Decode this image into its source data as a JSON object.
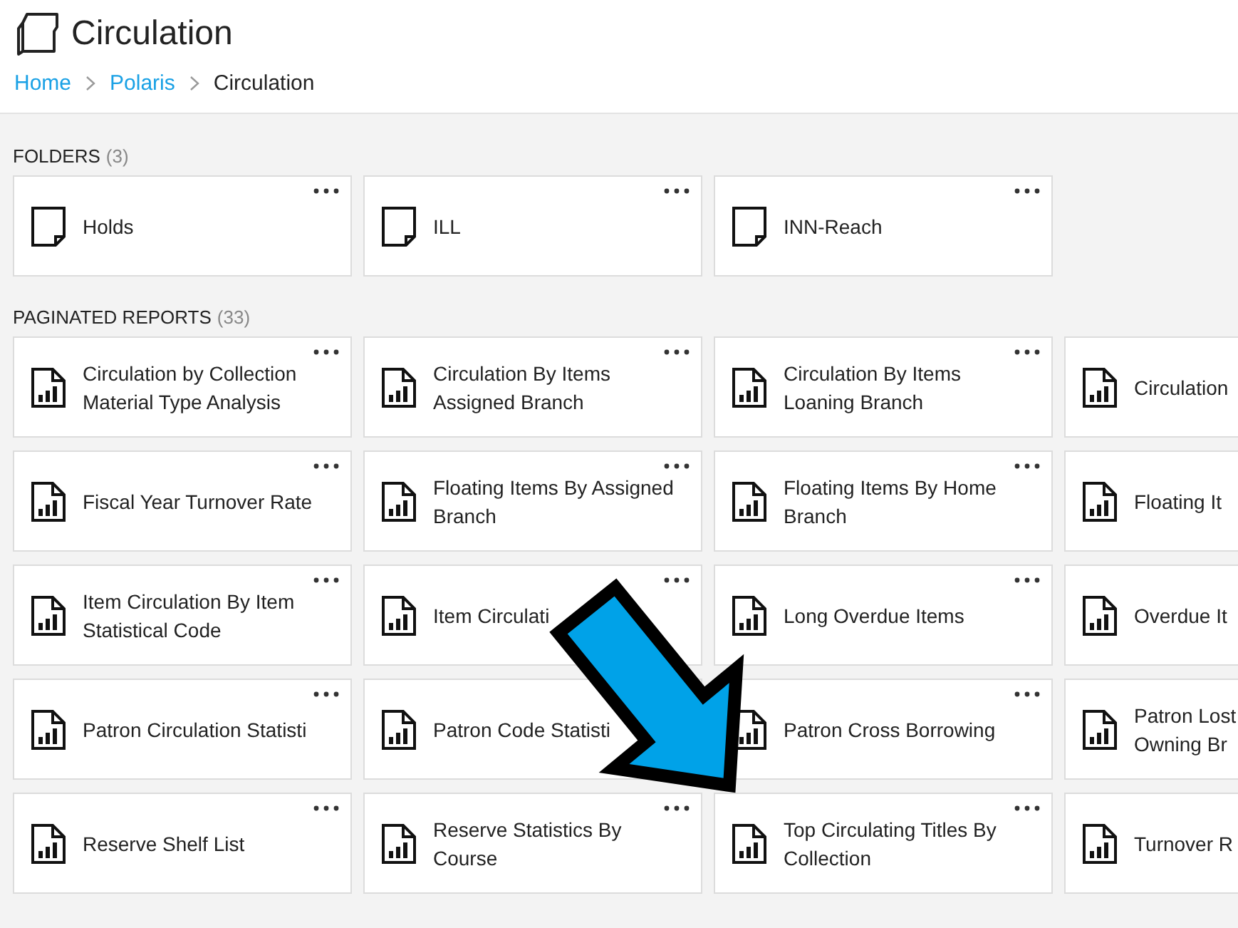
{
  "header": {
    "title": "Circulation",
    "breadcrumb": [
      {
        "label": "Home",
        "link": true
      },
      {
        "label": "Polaris",
        "link": true
      },
      {
        "label": "Circulation",
        "link": false
      }
    ]
  },
  "sections": [
    {
      "label": "FOLDERS",
      "count": "(3)",
      "items": [
        {
          "kind": "folder",
          "lines": [
            "Holds"
          ]
        },
        {
          "kind": "folder",
          "lines": [
            "ILL"
          ]
        },
        {
          "kind": "folder",
          "lines": [
            "INN-Reach"
          ]
        }
      ]
    },
    {
      "label": "PAGINATED REPORTS",
      "count": "(33)",
      "items": [
        {
          "kind": "report",
          "lines": [
            "Circulation by Collection",
            "Material Type Analysis"
          ]
        },
        {
          "kind": "report",
          "lines": [
            "Circulation By Items",
            "Assigned Branch"
          ]
        },
        {
          "kind": "report",
          "lines": [
            "Circulation By Items",
            "Loaning Branch"
          ]
        },
        {
          "kind": "report",
          "lines": [
            "Circulation"
          ]
        },
        {
          "kind": "report",
          "lines": [
            "Fiscal Year Turnover Rate"
          ]
        },
        {
          "kind": "report",
          "lines": [
            "Floating Items By Assigned",
            "Branch"
          ]
        },
        {
          "kind": "report",
          "lines": [
            "Floating Items By Home",
            "Branch"
          ]
        },
        {
          "kind": "report",
          "lines": [
            "Floating It"
          ]
        },
        {
          "kind": "report",
          "lines": [
            "Item Circulation By Item",
            "Statistical Code"
          ]
        },
        {
          "kind": "report",
          "lines": [
            "Item Circulati"
          ]
        },
        {
          "kind": "report",
          "lines": [
            "Long Overdue Items"
          ]
        },
        {
          "kind": "report",
          "lines": [
            "Overdue It"
          ]
        },
        {
          "kind": "report",
          "lines": [
            "Patron Circulation Statisti"
          ]
        },
        {
          "kind": "report",
          "lines": [
            "Patron Code Statisti"
          ]
        },
        {
          "kind": "report",
          "lines": [
            "Patron Cross Borrowing"
          ]
        },
        {
          "kind": "report",
          "lines": [
            "Patron Lost",
            "Owning Br"
          ]
        },
        {
          "kind": "report",
          "lines": [
            "Reserve Shelf List"
          ]
        },
        {
          "kind": "report",
          "lines": [
            "Reserve Statistics By",
            "Course"
          ]
        },
        {
          "kind": "report",
          "lines": [
            "Top Circulating Titles By",
            "Collection"
          ]
        },
        {
          "kind": "report",
          "lines": [
            "Turnover R"
          ]
        }
      ]
    }
  ]
}
